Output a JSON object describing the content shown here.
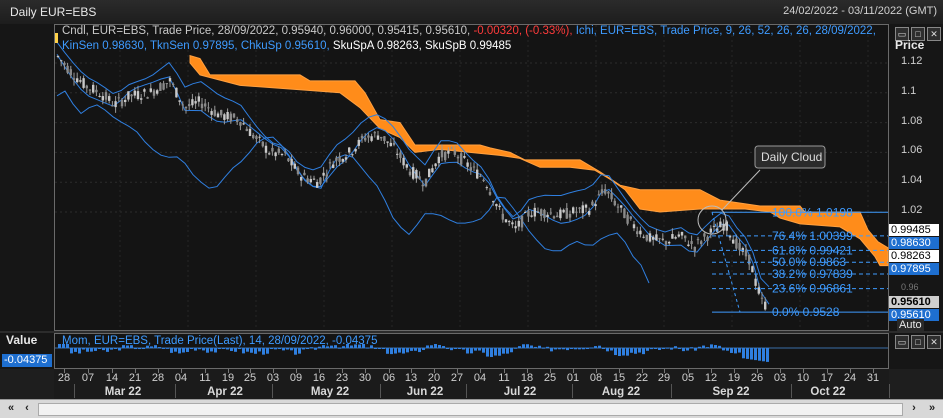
{
  "window": {
    "title": "Daily EUR=EBS",
    "date_range": "24/02/2022 - 03/11/2022 (GMT)"
  },
  "legend": {
    "candle_prefix": "Cndl, EUR=EBS, Trade Price, 28/09/2022, 0.95940, 0.96000, 0.95415, 0.95610,",
    "candle_change": "-0.00320, (-0.33%),",
    "ichi_line1": "Ichi, EUR=EBS, Trade Price, 9, 26, 52, 26, 26,",
    "ichi_line2": "28/09/2022, KinSen 0.98630, TknSen 0.97895, ChkuSp 0.95610,",
    "ichi_white": "SkuSpA 0.98263, SkuSpB 0.99485"
  },
  "price_axis": {
    "label": "Price",
    "ticks": [
      "1.12",
      "1.1",
      "1.08",
      "1.06",
      "1.04",
      "1.02",
      "0.96"
    ],
    "boxes": {
      "skuspb": "0.99485",
      "kinsen": "0.98630",
      "skuspa": "0.98263",
      "tknsen": "0.97895",
      "last": "0.95610",
      "chkusp": "0.95610"
    },
    "auto": "Auto"
  },
  "annotation": {
    "label": "Daily Cloud"
  },
  "fib_levels": [
    {
      "text": "100.0%  1.0198",
      "value": 1.0198
    },
    {
      "text": "76.4%  1.00399",
      "value": 1.00399
    },
    {
      "text": "61.8%  0.99421",
      "value": 0.99421
    },
    {
      "text": "50.0%  0.9863",
      "value": 0.9863
    },
    {
      "text": "38.2%  0.97839",
      "value": 0.97839
    },
    {
      "text": "23.6%  0.96861",
      "value": 0.96861
    },
    {
      "text": "0.0%   0.9528",
      "value": 0.9528
    }
  ],
  "momentum": {
    "panel_label": "Value",
    "legend": "Mom, EUR=EBS, Trade Price(Last), 14, 28/09/2022, -0.04375",
    "value": "-0.04375"
  },
  "x_axis": {
    "days": [
      "28",
      "07",
      "14",
      "21",
      "28",
      "04",
      "11",
      "19",
      "25",
      "03",
      "09",
      "16",
      "23",
      "30",
      "06",
      "13",
      "20",
      "27",
      "04",
      "11",
      "18",
      "25",
      "01",
      "08",
      "15",
      "22",
      "29",
      "05",
      "12",
      "19",
      "26",
      "03",
      "10",
      "17",
      "24",
      "31"
    ],
    "months": [
      "Mar 22",
      "Apr 22",
      "May 22",
      "Jun 22",
      "Jul 22",
      "Aug 22",
      "Sep 22",
      "Oct 22"
    ]
  },
  "icons": [
    "minimize-icon",
    "maximize-icon",
    "close-icon"
  ],
  "colors": {
    "cloud": "#ff8c1a",
    "ichimoku": "#2f7fe0",
    "up_candle": "#c8c8c8",
    "down_candle": "#8a8a8a",
    "fib": "#3e9bff",
    "negative": "#ff3b3b"
  }
}
